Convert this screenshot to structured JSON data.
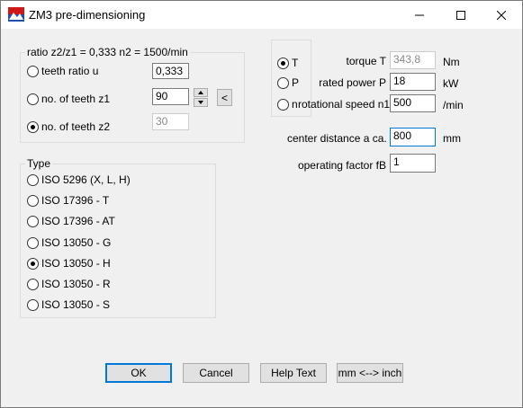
{
  "window": {
    "title": "ZM3 pre-dimensioning"
  },
  "ratio_group": {
    "title": "ratio z2/z1 = 0,333   n2 = 1500/min",
    "options": [
      {
        "label": "teeth ratio u",
        "checked": false,
        "value": "0,333",
        "enabled": true
      },
      {
        "label": "no. of teeth z1",
        "checked": false,
        "value": "90",
        "enabled": true
      },
      {
        "label": "no. of teeth z2",
        "checked": true,
        "value": "30",
        "enabled": false
      }
    ],
    "arrow_button_label": "<"
  },
  "mode_group": {
    "options": [
      {
        "label": "T",
        "checked": true
      },
      {
        "label": "P",
        "checked": false
      },
      {
        "label": "n",
        "checked": false
      }
    ]
  },
  "parameters": {
    "torque": {
      "label": "torque T",
      "value": "343,8",
      "unit": "Nm",
      "enabled": false
    },
    "power": {
      "label": "rated power P",
      "value": "18",
      "unit": "kW",
      "enabled": true
    },
    "speed": {
      "label": "rotational speed n1",
      "value": "500",
      "unit": "/min",
      "enabled": true
    },
    "center_distance": {
      "label": "center distance a ca.",
      "value": "800",
      "unit": "mm",
      "enabled": true
    },
    "operating_factor": {
      "label": "operating factor fB",
      "value": "1",
      "enabled": true
    }
  },
  "type_group": {
    "title": "Type",
    "options": [
      {
        "label": "ISO 5296 (X, L, H)",
        "checked": false
      },
      {
        "label": "ISO 17396 - T",
        "checked": false
      },
      {
        "label": "ISO 17396 - AT",
        "checked": false
      },
      {
        "label": "ISO 13050 - G",
        "checked": false
      },
      {
        "label": "ISO 13050 - H",
        "checked": true
      },
      {
        "label": "ISO 13050 - R",
        "checked": false
      },
      {
        "label": "ISO 13050 - S",
        "checked": false
      }
    ]
  },
  "buttons": {
    "ok": "OK",
    "cancel": "Cancel",
    "help": "Help Text",
    "units": "mm <--> inch"
  },
  "icons": {
    "app": "app-logo-icon",
    "minimize": "minimize-icon",
    "maximize": "maximize-icon",
    "close": "close-icon",
    "spin_up": "spin-up-icon",
    "spin_down": "spin-down-icon"
  },
  "colors": {
    "window_bg": "#f0f0f0",
    "focus_blue": "#0078d7",
    "disabled_text": "#8a8a8a"
  }
}
